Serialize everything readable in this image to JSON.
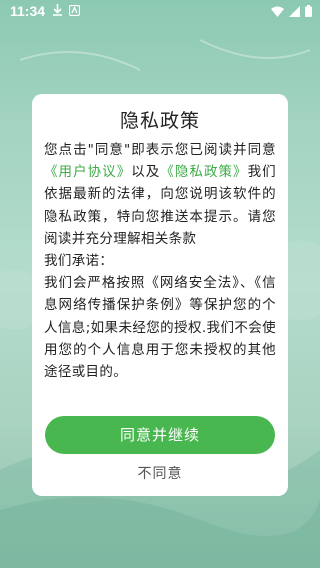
{
  "status_bar": {
    "time": "11:34",
    "left_icons": [
      "download-icon",
      "app-notification-icon"
    ],
    "right_icons": [
      "wifi-icon",
      "signal-icon",
      "battery-icon"
    ]
  },
  "dialog": {
    "title": "隐私政策",
    "body": {
      "intro_1": "您点击\"同意\"即表示您已阅读并同意",
      "user_agreement_link": "《用户协议》",
      "and_text": "以及",
      "privacy_policy_link": "《隐私政策》",
      "intro_2": "我们依据最新的法律，向您说明该软件的隐私政策，特向您推送本提示。请您阅读并充分理解相关条款",
      "commitment_heading": "我们承诺：",
      "commitment_text": "我们会严格按照《网络安全法》、《信息网络传播保护条例》等保护您的个人信息;如果未经您的授权.我们不会使用您的个人信息用于您未授权的其他途径或目的。"
    },
    "agree_button": "同意并继续",
    "disagree_button": "不同意"
  },
  "colors": {
    "accent": "#48b74f",
    "link": "#3dab47",
    "background": "#a3d4c1"
  }
}
